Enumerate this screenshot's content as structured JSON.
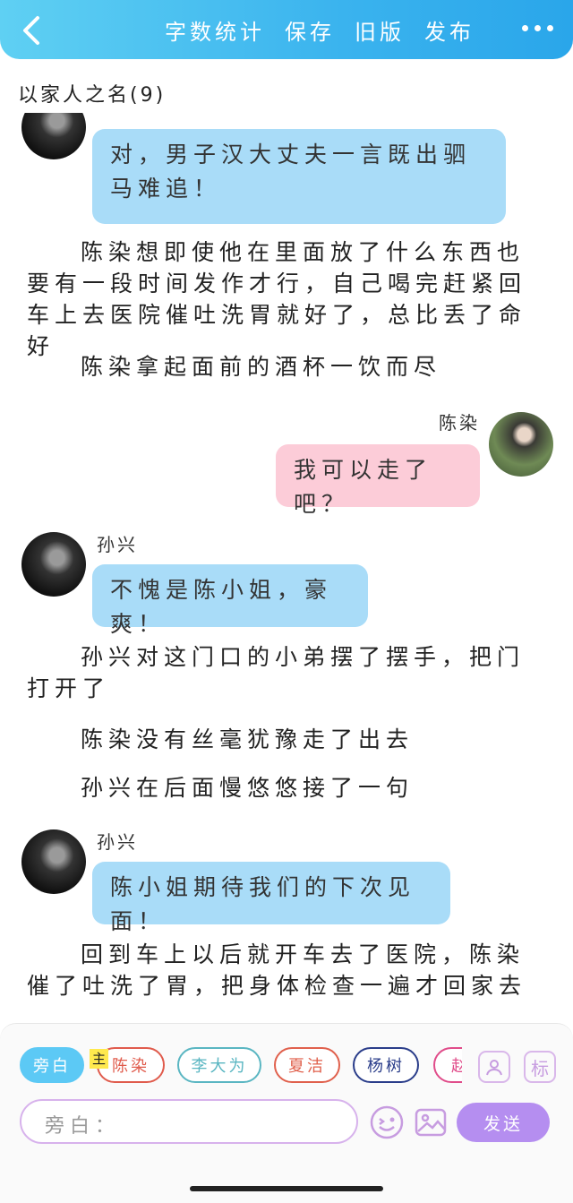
{
  "header": {
    "actions": [
      "字数统计",
      "保存",
      "旧版",
      "发布"
    ]
  },
  "book": {
    "title": "以家人之名(9)"
  },
  "messages": {
    "m1": {
      "text": "对，男子汉大丈夫一言既出驷马难追！"
    },
    "p1": "陈染想即使他在里面放了什么东西也要有一段时间发作才行，自己喝完赶紧回车上去医院催吐洗胃就好了，总比丢了命好",
    "p2": "陈染拿起面前的酒杯一饮而尽",
    "m2": {
      "name": "陈染",
      "text": "我可以走了吧？"
    },
    "m3": {
      "name": "孙兴",
      "text": "不愧是陈小姐，豪爽！"
    },
    "p3": "孙兴对这门口的小弟摆了摆手，把门打开了",
    "p4": "陈染没有丝毫犹豫走了出去",
    "p5": "孙兴在后面慢悠悠接了一句",
    "m4": {
      "name": "孙兴",
      "text": "陈小姐期待我们的下次见面！"
    },
    "p6": "回到车上以后就开车去了医院，陈染催了吐洗了胃，把身体检查一遍才回家去"
  },
  "composer": {
    "roles": [
      {
        "label": "旁白",
        "color": "#5cc9f5"
      },
      {
        "label": "陈染",
        "color": "#e05b4c"
      },
      {
        "label": "李大为",
        "color": "#5ab6c2"
      },
      {
        "label": "夏洁",
        "color": "#e0604c"
      },
      {
        "label": "杨树",
        "color": "#2a3d8a"
      },
      {
        "label": "赵",
        "color": "#e04c8a"
      }
    ],
    "main_tag": "主",
    "tag_button": "标",
    "placeholder": "旁白：",
    "send_label": "发送"
  }
}
